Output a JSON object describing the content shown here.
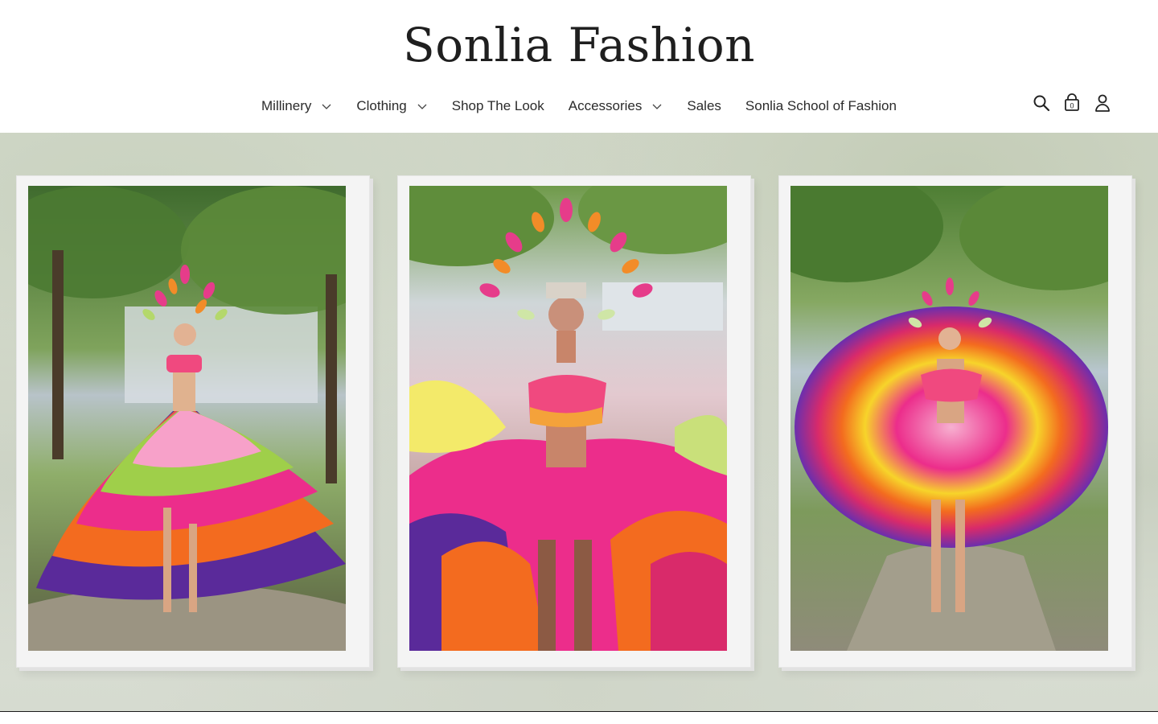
{
  "site": {
    "title": "Sonlia Fashion"
  },
  "nav": {
    "items": [
      {
        "label": "Millinery",
        "has_dropdown": true
      },
      {
        "label": "Clothing",
        "has_dropdown": true
      },
      {
        "label": "Shop The Look",
        "has_dropdown": false
      },
      {
        "label": "Accessories",
        "has_dropdown": true
      },
      {
        "label": "Sales",
        "has_dropdown": false
      },
      {
        "label": "Sonlia School of Fashion",
        "has_dropdown": false
      }
    ]
  },
  "header_icons": {
    "search": "search-icon",
    "cart": "cart-icon",
    "cart_count": "0",
    "account": "account-icon"
  },
  "hero": {
    "images": [
      {
        "name": "hero-photo-1"
      },
      {
        "name": "hero-photo-2"
      },
      {
        "name": "hero-photo-3"
      }
    ]
  },
  "colors": {
    "text": "#1f1f1f",
    "nav_text": "#2b2b2b",
    "frame": "#f4f4f4"
  }
}
